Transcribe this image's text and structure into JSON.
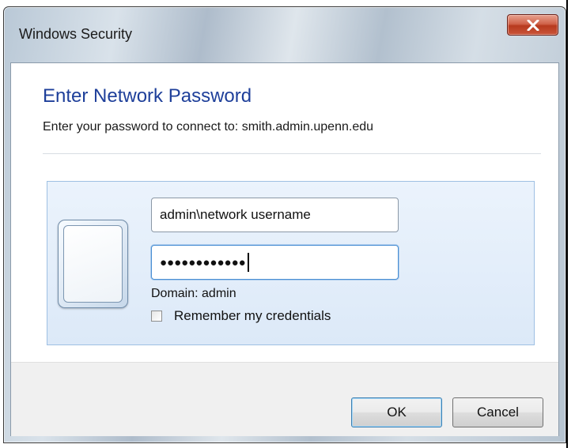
{
  "window": {
    "title": "Windows Security",
    "close_label": "X"
  },
  "dialog": {
    "heading": "Enter Network Password",
    "subtext": "Enter your password to connect to: smith.admin.upenn.edu"
  },
  "credentials": {
    "username_value": "admin\\network username",
    "password_masked": "●●●●●●●●●●●●",
    "domain_text": "Domain: admin",
    "remember_label": "Remember my credentials",
    "remember_checked": false
  },
  "buttons": {
    "ok_label": "OK",
    "cancel_label": "Cancel"
  },
  "colors": {
    "heading": "#1e3f9a",
    "close_button": "#c9553a",
    "panel_bg": "#dce9f8"
  }
}
